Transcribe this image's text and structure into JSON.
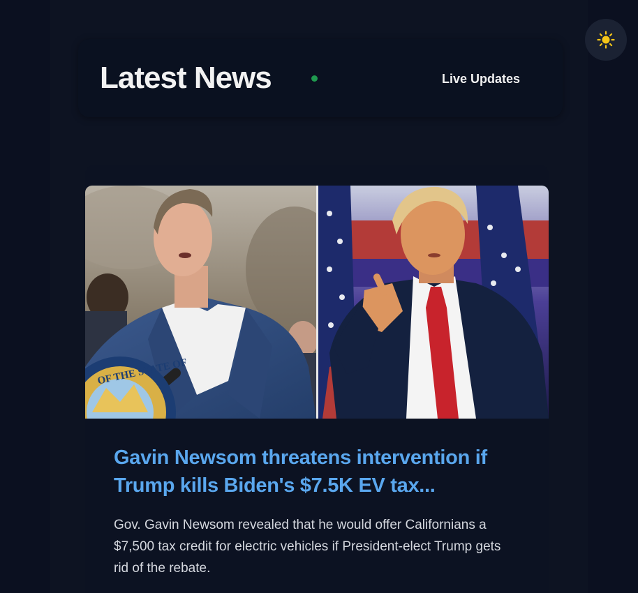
{
  "header": {
    "title": "Latest News",
    "live_label": "Live Updates",
    "live_dot_color": "#1f9a4f"
  },
  "theme_toggle": {
    "icon": "sun-icon",
    "icon_color": "#f5c518"
  },
  "article": {
    "image_description_icon": "news-photo",
    "title": "Gavin Newsom threatens intervention if Trump kills Biden's $7.5K EV tax...",
    "summary": "Gov. Gavin Newsom revealed that he would offer Californians a $7,500 tax credit for electric vehicles if President-elect Trump gets rid of the rebate.",
    "seal_text": "OF THE STATE OF",
    "title_color": "#5aa7ee"
  }
}
